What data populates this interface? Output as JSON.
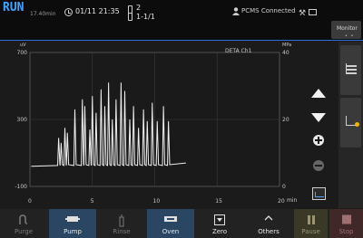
{
  "header": {
    "run_status": "RUN",
    "elapsed": "17.40min",
    "datetime": "01/11 21:35",
    "vial_number": "2",
    "vial_position": "1-1/1",
    "connection": "PCMS Connected",
    "monitor_label": "Monitor",
    "monitor_dots": "• •"
  },
  "chart_data": {
    "type": "line",
    "legend": "DETA Ch1",
    "y_left_unit": "uV",
    "y_right_unit": "MPa",
    "x_unit": "min",
    "x_ticks": [
      "0",
      "5",
      "10",
      "15",
      "20"
    ],
    "y_left_ticks": [
      "700",
      "300",
      "-100"
    ],
    "y_right_ticks": [
      "40",
      "20",
      "0"
    ],
    "xlim": [
      0,
      20
    ],
    "ylim": [
      -100,
      700
    ],
    "grid": true,
    "baseline_end_x": 12.5,
    "peaks": [
      {
        "x": 2.3,
        "y": 190
      },
      {
        "x": 2.5,
        "y": 160
      },
      {
        "x": 2.8,
        "y": 250
      },
      {
        "x": 3.0,
        "y": 220
      },
      {
        "x": 3.6,
        "y": 360
      },
      {
        "x": 4.2,
        "y": 420
      },
      {
        "x": 4.4,
        "y": 380
      },
      {
        "x": 4.8,
        "y": 240
      },
      {
        "x": 5.0,
        "y": 440
      },
      {
        "x": 5.3,
        "y": 340
      },
      {
        "x": 5.7,
        "y": 480
      },
      {
        "x": 6.0,
        "y": 380
      },
      {
        "x": 6.3,
        "y": 520
      },
      {
        "x": 6.6,
        "y": 300
      },
      {
        "x": 6.9,
        "y": 420
      },
      {
        "x": 7.3,
        "y": 520
      },
      {
        "x": 7.6,
        "y": 470
      },
      {
        "x": 8.0,
        "y": 300
      },
      {
        "x": 8.3,
        "y": 380
      },
      {
        "x": 8.7,
        "y": 250
      },
      {
        "x": 9.1,
        "y": 360
      },
      {
        "x": 9.4,
        "y": 290
      },
      {
        "x": 9.8,
        "y": 400
      },
      {
        "x": 10.2,
        "y": 290
      },
      {
        "x": 10.7,
        "y": 380
      },
      {
        "x": 11.1,
        "y": 290
      }
    ]
  },
  "controls": {
    "zoom_in": "zoom in",
    "zoom_out": "zoom out"
  },
  "bottom_bar": {
    "purge": "Purge",
    "pump": "Pump",
    "rinse": "Rinse",
    "oven": "Oven",
    "zero": "Zero",
    "others": "Others",
    "pause": "Pause",
    "stop": "Stop"
  },
  "colors": {
    "accent": "#3fa6ff",
    "trace": "#f0f0f0",
    "active_button": "#2a4663"
  }
}
